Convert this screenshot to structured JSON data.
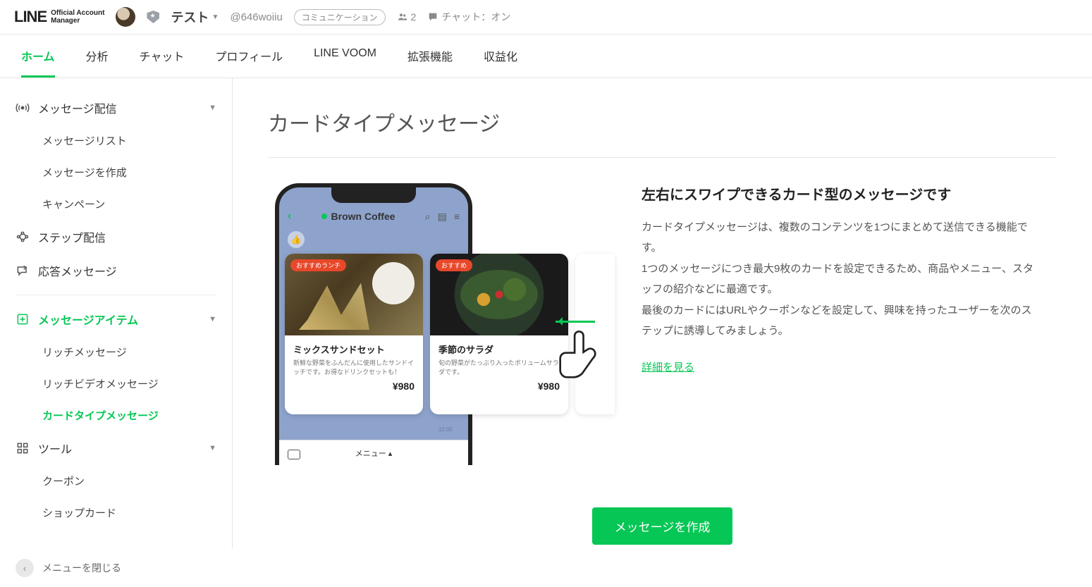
{
  "header": {
    "logo_main": "LINE",
    "logo_sub1": "Official Account",
    "logo_sub2": "Manager",
    "account_name": "テスト",
    "account_id": "@646woiiu",
    "tag": "コミュニケーション",
    "followers": "2",
    "chat_status": "チャット：オン"
  },
  "tabs": [
    {
      "label": "ホーム",
      "active": true
    },
    {
      "label": "分析"
    },
    {
      "label": "チャット"
    },
    {
      "label": "プロフィール"
    },
    {
      "label": "LINE VOOM"
    },
    {
      "label": "拡張機能"
    },
    {
      "label": "収益化"
    }
  ],
  "sidebar": {
    "section_message": {
      "label": "メッセージ配信"
    },
    "msg_list": "メッセージリスト",
    "msg_create": "メッセージを作成",
    "campaign": "キャンペーン",
    "step": "ステップ配信",
    "auto_reply": "応答メッセージ",
    "section_items": {
      "label": "メッセージアイテム"
    },
    "rich_msg": "リッチメッセージ",
    "rich_video": "リッチビデオメッセージ",
    "card_type": "カードタイプメッセージ",
    "section_tools": {
      "label": "ツール"
    },
    "coupon": "クーポン",
    "shop_card": "ショップカード",
    "collapse": "メニューを閉じる"
  },
  "main": {
    "title": "カードタイプメッセージ",
    "phone": {
      "name": "Brown Coffee",
      "card1": {
        "tag": "おすすめランチ",
        "title": "ミックスサンドセット",
        "desc": "新鮮な野菜をふんだんに使用したサンドイッチです。お得なドリンクセットも！",
        "price": "¥980"
      },
      "card2": {
        "tag": "おすすめ",
        "title": "季節のサラダ",
        "desc": "旬の野菜がたっぷり入ったボリュームサラダです。",
        "price": "¥980"
      },
      "time": "12:00",
      "menu": "メニュー ▴"
    },
    "desc": {
      "heading": "左右にスワイプできるカード型のメッセージです",
      "p1": "カードタイプメッセージは、複数のコンテンツを1つにまとめて送信できる機能です。",
      "p2": "1つのメッセージにつき最大9枚のカードを設定できるため、商品やメニュー、スタッフの紹介などに最適です。",
      "p3": "最後のカードにはURLやクーポンなどを設定して、興味を持ったユーザーを次のステップに誘導してみましょう。",
      "link": "詳細を見る"
    },
    "cta": "メッセージを作成"
  }
}
